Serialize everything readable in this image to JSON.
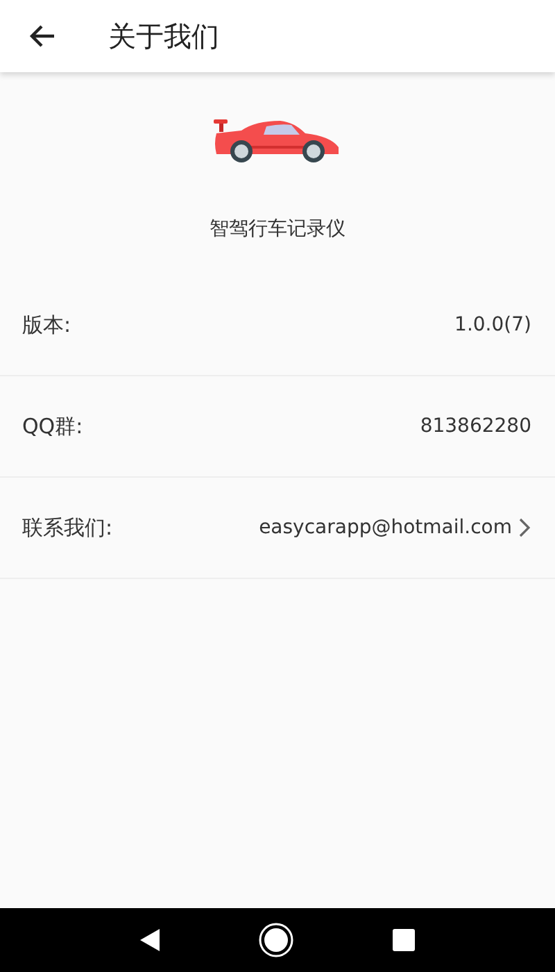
{
  "header": {
    "title": "关于我们"
  },
  "app": {
    "name": "智驾行车记录仪"
  },
  "rows": [
    {
      "kind": "info",
      "label": "版本:",
      "value": "1.0.0(7)"
    },
    {
      "kind": "info",
      "label": "QQ群:",
      "value": "813862280"
    },
    {
      "kind": "link",
      "label": "联系我们:",
      "value": "easycarapp@hotmail.com"
    }
  ]
}
